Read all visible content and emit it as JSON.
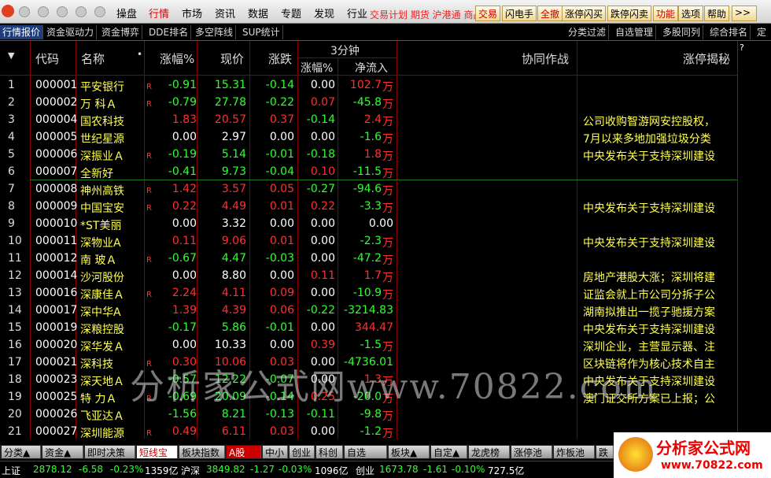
{
  "menu": [
    "操盘",
    "行情",
    "市场",
    "资讯",
    "数据",
    "专题",
    "发现",
    "行业"
  ],
  "menu_overlap_text": "交易计划  期货  沪港通  商品",
  "tool_buttons": [
    "交易",
    "闪电手",
    "全撤",
    "涨停闪买",
    "跌停闪卖",
    "功能",
    "选项",
    "帮助",
    ">>"
  ],
  "tabs": [
    "行情报价",
    "资金驱动力",
    "资金博弈",
    "DDE排名",
    "多空阵线",
    "SUP统计"
  ],
  "right_tabs": [
    "分类过滤",
    "自选管理",
    "多股同列",
    "综合排名",
    "定"
  ],
  "headers": {
    "code": "代码",
    "name": "名称",
    "pct": "涨幅%",
    "price": "现价",
    "chg": "涨跌",
    "group3": "3分钟",
    "pct3": "涨幅%",
    "flow": "净流入",
    "collab": "协同作战",
    "reveal": "涨停揭秘",
    "q": "?"
  },
  "wan_unit": "万",
  "rows": [
    {
      "idx": "1",
      "code": "000001",
      "name": "平安银行",
      "r": "R",
      "pct": "-0.91",
      "price": "15.31",
      "chg": "-0.14",
      "pct3": "0.00",
      "flow": "102.7",
      "news": ""
    },
    {
      "idx": "2",
      "code": "000002",
      "name": "万 科Ａ",
      "r": "R",
      "pct": "-0.79",
      "price": "27.78",
      "chg": "-0.22",
      "pct3": "0.07",
      "flow": "-45.8",
      "news": ""
    },
    {
      "idx": "3",
      "code": "000004",
      "name": "国农科技",
      "r": "",
      "pct": "1.83",
      "price": "20.57",
      "chg": "0.37",
      "pct3": "-0.14",
      "flow": "2.4",
      "news": "公司收购智游网安控股权，"
    },
    {
      "idx": "4",
      "code": "000005",
      "name": "世纪星源",
      "r": "",
      "pct": "0.00",
      "price": "2.97",
      "chg": "0.00",
      "pct3": "0.00",
      "flow": "-1.6",
      "news": "7月以来多地加强垃圾分类"
    },
    {
      "idx": "5",
      "code": "000006",
      "name": "深振业Ａ",
      "r": "R",
      "pct": "-0.19",
      "price": "5.14",
      "chg": "-0.01",
      "pct3": "-0.18",
      "flow": "1.8",
      "news": "中央发布关于支持深圳建设"
    },
    {
      "idx": "6",
      "code": "000007",
      "name": "全新好",
      "r": "",
      "pct": "-0.41",
      "price": "9.73",
      "chg": "-0.04",
      "pct3": "0.10",
      "flow": "-11.5",
      "news": ""
    },
    {
      "idx": "7",
      "code": "000008",
      "name": "神州高铁",
      "r": "R",
      "pct": "1.42",
      "price": "3.57",
      "chg": "0.05",
      "pct3": "-0.27",
      "flow": "-94.6",
      "news": ""
    },
    {
      "idx": "8",
      "code": "000009",
      "name": "中国宝安",
      "r": "R",
      "pct": "0.22",
      "price": "4.49",
      "chg": "0.01",
      "pct3": "0.22",
      "flow": "-3.3",
      "news": "中央发布关于支持深圳建设"
    },
    {
      "idx": "9",
      "code": "000010",
      "name": "*ST美丽",
      "r": "",
      "pct": "0.00",
      "price": "3.32",
      "chg": "0.00",
      "pct3": "0.00",
      "flow": "0.00",
      "news": ""
    },
    {
      "idx": "10",
      "code": "000011",
      "name": "深物业A",
      "r": "",
      "pct": "0.11",
      "price": "9.06",
      "chg": "0.01",
      "pct3": "0.00",
      "flow": "-2.3",
      "news": "中央发布关于支持深圳建设"
    },
    {
      "idx": "11",
      "code": "000012",
      "name": "南 玻Ａ",
      "r": "R",
      "pct": "-0.67",
      "price": "4.47",
      "chg": "-0.03",
      "pct3": "0.00",
      "flow": "-47.2",
      "news": ""
    },
    {
      "idx": "12",
      "code": "000014",
      "name": "沙河股份",
      "r": "",
      "pct": "0.00",
      "price": "8.80",
      "chg": "0.00",
      "pct3": "0.11",
      "flow": "1.7",
      "news": "房地产港股大涨；深圳将建"
    },
    {
      "idx": "13",
      "code": "000016",
      "name": "深康佳Ａ",
      "r": "R",
      "pct": "2.24",
      "price": "4.11",
      "chg": "0.09",
      "pct3": "0.00",
      "flow": "-10.9",
      "news": "证监会就上市公司分拆子公"
    },
    {
      "idx": "14",
      "code": "000017",
      "name": "深中华A",
      "r": "",
      "pct": "1.39",
      "price": "4.39",
      "chg": "0.06",
      "pct3": "-0.22",
      "flow": "-3214.83",
      "news": "湖南拟推出一揽子驰援方案"
    },
    {
      "idx": "15",
      "code": "000019",
      "name": "深粮控股",
      "r": "",
      "pct": "-0.17",
      "price": "5.86",
      "chg": "-0.01",
      "pct3": "0.00",
      "flow": "344.47",
      "news": "中央发布关于支持深圳建设"
    },
    {
      "idx": "16",
      "code": "000020",
      "name": "深华发Ａ",
      "r": "",
      "pct": "0.00",
      "price": "10.33",
      "chg": "0.00",
      "pct3": "0.39",
      "flow": "-1.5",
      "news": "深圳企业，主营显示器、注"
    },
    {
      "idx": "17",
      "code": "000021",
      "name": "深科技",
      "r": "R",
      "pct": "0.30",
      "price": "10.06",
      "chg": "0.03",
      "pct3": "0.00",
      "flow": "-4736.01",
      "news": "区块链将作为核心技术自主"
    },
    {
      "idx": "18",
      "code": "000023",
      "name": "深天地Ａ",
      "r": "",
      "pct": "-0.57",
      "price": "12.22",
      "chg": "-0.07",
      "pct3": "0.00",
      "flow": "1.3",
      "news": "中央发布关于支持深圳建设"
    },
    {
      "idx": "19",
      "code": "000025",
      "name": "特 力Ａ",
      "r": "R",
      "pct": "-0.69",
      "price": "20.09",
      "chg": "-0.14",
      "pct3": "0.25",
      "flow": "-20.0",
      "news": "澳门证交所方案已上报；公"
    },
    {
      "idx": "20",
      "code": "000026",
      "name": "飞亚达Ａ",
      "r": "",
      "pct": "-1.56",
      "price": "8.21",
      "chg": "-0.13",
      "pct3": "-0.11",
      "flow": "-9.8",
      "news": ""
    },
    {
      "idx": "21",
      "code": "000027",
      "name": "深圳能源",
      "r": "R",
      "pct": "0.49",
      "price": "6.11",
      "chg": "0.03",
      "pct3": "0.00",
      "flow": "-1.2",
      "news": ""
    }
  ],
  "bottom_tabs": [
    "分类▲",
    "资金▲",
    "即时决策",
    "短线宝",
    "板块指数",
    "A股",
    "中小",
    "创业",
    "科创",
    "自选",
    "板块▲",
    "自定▲",
    "龙虎榜",
    "涨停池",
    "炸板池",
    "跌"
  ],
  "status": {
    "sh_label": "上证",
    "sh_val": "2878.12",
    "sh_chg": "-6.58",
    "sh_pct": "-0.23%",
    "sh_amt": "1359亿",
    "hs_label": "沪深",
    "hs_val": "3849.82",
    "hs_chg": "-1.27",
    "hs_pct": "-0.03%",
    "hs_amt": "1096亿",
    "cy_label": "创业",
    "cy_val": "1673.78",
    "cy_chg": "-1.61",
    "cy_pct": "-0.10%",
    "cy_amt": "727.5亿"
  },
  "brand": {
    "title": "分析家公式网",
    "url": "www.70822.com"
  },
  "watermark": "分析家公式网www.70822.com"
}
